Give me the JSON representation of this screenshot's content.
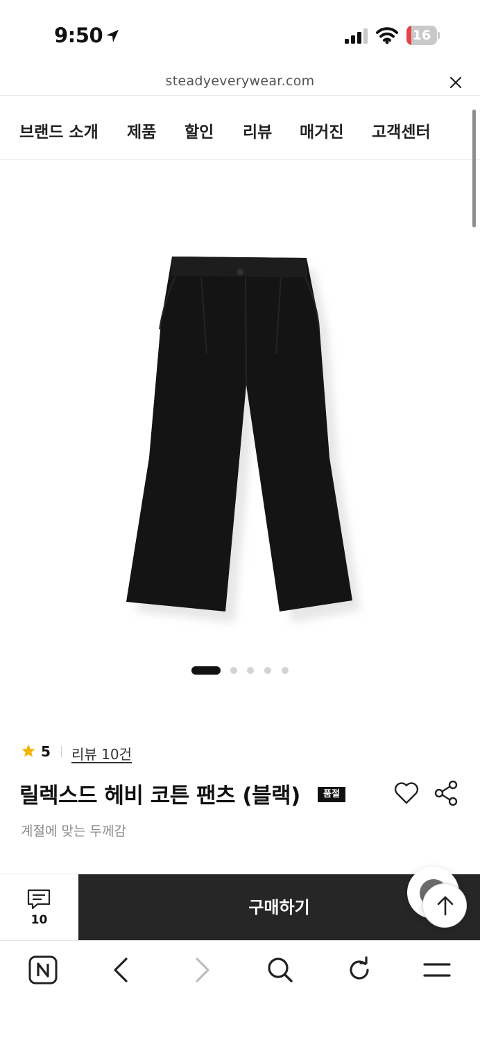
{
  "status_bar": {
    "time": "9:50",
    "battery_level": "16",
    "battery_fraction": 0.16
  },
  "browser": {
    "url": "steadyeverywear.com"
  },
  "nav": {
    "items": [
      {
        "label": "브랜드 소개"
      },
      {
        "label": "제품"
      },
      {
        "label": "할인"
      },
      {
        "label": "리뷰"
      },
      {
        "label": "매거진"
      },
      {
        "label": "고객센터"
      }
    ]
  },
  "gallery": {
    "image_count": 5,
    "active_index": 0
  },
  "product": {
    "rating": "5",
    "review_link": "리뷰 10건",
    "title": "릴렉스드 헤비 코튼 팬츠 (블랙)",
    "badge": "품절",
    "subtitle": "계절에 맞는 두께감"
  },
  "purchase_bar": {
    "review_count": "10",
    "buy_label": "구매하기"
  },
  "icons": {
    "location": "location-arrow-icon",
    "signal": "cellular-signal-icon",
    "wifi": "wifi-icon",
    "close": "close-icon",
    "star": "star-icon",
    "heart": "heart-icon",
    "share": "share-icon",
    "chat": "chat-bubble-icon",
    "scroll_top": "arrow-up-icon"
  },
  "colors": {
    "star": "#F5B400",
    "buy_button": "#262626",
    "battery_low": "#E8414A"
  }
}
